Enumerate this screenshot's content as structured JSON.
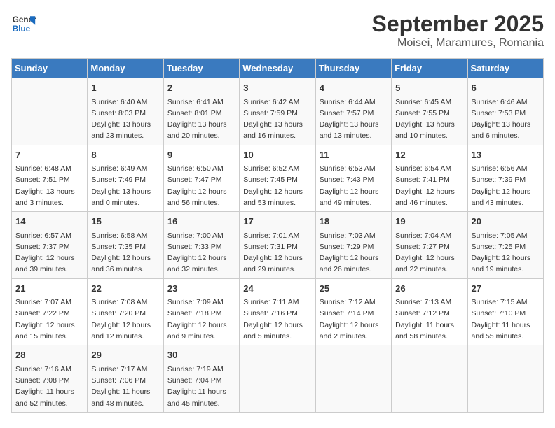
{
  "logo": {
    "line1": "General",
    "line2": "Blue"
  },
  "title": "September 2025",
  "subtitle": "Moisei, Maramures, Romania",
  "days_of_week": [
    "Sunday",
    "Monday",
    "Tuesday",
    "Wednesday",
    "Thursday",
    "Friday",
    "Saturday"
  ],
  "weeks": [
    [
      {
        "day": "",
        "info": ""
      },
      {
        "day": "1",
        "info": "Sunrise: 6:40 AM\nSunset: 8:03 PM\nDaylight: 13 hours\nand 23 minutes."
      },
      {
        "day": "2",
        "info": "Sunrise: 6:41 AM\nSunset: 8:01 PM\nDaylight: 13 hours\nand 20 minutes."
      },
      {
        "day": "3",
        "info": "Sunrise: 6:42 AM\nSunset: 7:59 PM\nDaylight: 13 hours\nand 16 minutes."
      },
      {
        "day": "4",
        "info": "Sunrise: 6:44 AM\nSunset: 7:57 PM\nDaylight: 13 hours\nand 13 minutes."
      },
      {
        "day": "5",
        "info": "Sunrise: 6:45 AM\nSunset: 7:55 PM\nDaylight: 13 hours\nand 10 minutes."
      },
      {
        "day": "6",
        "info": "Sunrise: 6:46 AM\nSunset: 7:53 PM\nDaylight: 13 hours\nand 6 minutes."
      }
    ],
    [
      {
        "day": "7",
        "info": "Sunrise: 6:48 AM\nSunset: 7:51 PM\nDaylight: 13 hours\nand 3 minutes."
      },
      {
        "day": "8",
        "info": "Sunrise: 6:49 AM\nSunset: 7:49 PM\nDaylight: 13 hours\nand 0 minutes."
      },
      {
        "day": "9",
        "info": "Sunrise: 6:50 AM\nSunset: 7:47 PM\nDaylight: 12 hours\nand 56 minutes."
      },
      {
        "day": "10",
        "info": "Sunrise: 6:52 AM\nSunset: 7:45 PM\nDaylight: 12 hours\nand 53 minutes."
      },
      {
        "day": "11",
        "info": "Sunrise: 6:53 AM\nSunset: 7:43 PM\nDaylight: 12 hours\nand 49 minutes."
      },
      {
        "day": "12",
        "info": "Sunrise: 6:54 AM\nSunset: 7:41 PM\nDaylight: 12 hours\nand 46 minutes."
      },
      {
        "day": "13",
        "info": "Sunrise: 6:56 AM\nSunset: 7:39 PM\nDaylight: 12 hours\nand 43 minutes."
      }
    ],
    [
      {
        "day": "14",
        "info": "Sunrise: 6:57 AM\nSunset: 7:37 PM\nDaylight: 12 hours\nand 39 minutes."
      },
      {
        "day": "15",
        "info": "Sunrise: 6:58 AM\nSunset: 7:35 PM\nDaylight: 12 hours\nand 36 minutes."
      },
      {
        "day": "16",
        "info": "Sunrise: 7:00 AM\nSunset: 7:33 PM\nDaylight: 12 hours\nand 32 minutes."
      },
      {
        "day": "17",
        "info": "Sunrise: 7:01 AM\nSunset: 7:31 PM\nDaylight: 12 hours\nand 29 minutes."
      },
      {
        "day": "18",
        "info": "Sunrise: 7:03 AM\nSunset: 7:29 PM\nDaylight: 12 hours\nand 26 minutes."
      },
      {
        "day": "19",
        "info": "Sunrise: 7:04 AM\nSunset: 7:27 PM\nDaylight: 12 hours\nand 22 minutes."
      },
      {
        "day": "20",
        "info": "Sunrise: 7:05 AM\nSunset: 7:25 PM\nDaylight: 12 hours\nand 19 minutes."
      }
    ],
    [
      {
        "day": "21",
        "info": "Sunrise: 7:07 AM\nSunset: 7:22 PM\nDaylight: 12 hours\nand 15 minutes."
      },
      {
        "day": "22",
        "info": "Sunrise: 7:08 AM\nSunset: 7:20 PM\nDaylight: 12 hours\nand 12 minutes."
      },
      {
        "day": "23",
        "info": "Sunrise: 7:09 AM\nSunset: 7:18 PM\nDaylight: 12 hours\nand 9 minutes."
      },
      {
        "day": "24",
        "info": "Sunrise: 7:11 AM\nSunset: 7:16 PM\nDaylight: 12 hours\nand 5 minutes."
      },
      {
        "day": "25",
        "info": "Sunrise: 7:12 AM\nSunset: 7:14 PM\nDaylight: 12 hours\nand 2 minutes."
      },
      {
        "day": "26",
        "info": "Sunrise: 7:13 AM\nSunset: 7:12 PM\nDaylight: 11 hours\nand 58 minutes."
      },
      {
        "day": "27",
        "info": "Sunrise: 7:15 AM\nSunset: 7:10 PM\nDaylight: 11 hours\nand 55 minutes."
      }
    ],
    [
      {
        "day": "28",
        "info": "Sunrise: 7:16 AM\nSunset: 7:08 PM\nDaylight: 11 hours\nand 52 minutes."
      },
      {
        "day": "29",
        "info": "Sunrise: 7:17 AM\nSunset: 7:06 PM\nDaylight: 11 hours\nand 48 minutes."
      },
      {
        "day": "30",
        "info": "Sunrise: 7:19 AM\nSunset: 7:04 PM\nDaylight: 11 hours\nand 45 minutes."
      },
      {
        "day": "",
        "info": ""
      },
      {
        "day": "",
        "info": ""
      },
      {
        "day": "",
        "info": ""
      },
      {
        "day": "",
        "info": ""
      }
    ]
  ]
}
